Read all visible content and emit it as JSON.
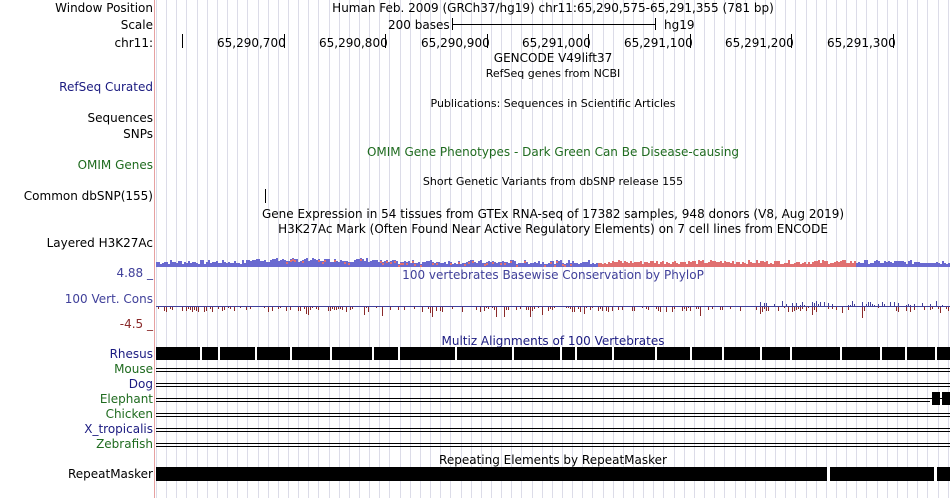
{
  "labels": {
    "window_position": "Window Position",
    "scale": "Scale",
    "chrom": "chr11:",
    "refseq_curated": "RefSeq Curated",
    "sequences": "Sequences",
    "snps": "SNPs",
    "omim_genes": "OMIM Genes",
    "common_dbsnp": "Common dbSNP(155)",
    "layered_h3k27ac": "Layered H3K27Ac",
    "cons_max": "4.88 _",
    "cons_label": "100 Vert. Cons",
    "cons_min": "-4.5 _",
    "rhesus": "Rhesus",
    "mouse": "Mouse",
    "dog": "Dog",
    "elephant": "Elephant",
    "chicken": "Chicken",
    "x_tropicalis": "X_tropicalis",
    "zebrafish": "Zebrafish",
    "repeatmasker": "RepeatMasker"
  },
  "header": {
    "position_text": "Human Feb. 2009 (GRCh37/hg19)   chr11:65,290,575-65,291,355 (781 bp)",
    "scale_text": "200 bases",
    "assembly": "hg19"
  },
  "ruler": {
    "ticks": [
      "65,290,700",
      "65,290,800",
      "65,290,900",
      "65,291,000",
      "65,291,100",
      "65,291,200",
      "65,291,300"
    ]
  },
  "tracks": {
    "gencode": "GENCODE V49lift37",
    "refseq": "RefSeq genes from NCBI",
    "publications": "Publications: Sequences in Scientific Articles",
    "omim": "OMIM Gene Phenotypes - Dark Green Can Be Disease-causing",
    "dbsnp": "Short Genetic Variants from dbSNP release 155",
    "gtex": "Gene Expression in 54 tissues from GTEx RNA-seq of 17382 samples, 948 donors (V8, Aug 2019)",
    "h3k27ac": "H3K27Ac Mark (Often Found Near Active Regulatory Elements) on 7 cell lines from ENCODE",
    "phylop": "100 vertebrates Basewise Conservation by PhyloP",
    "multiz": "Multiz Alignments of 100 Vertebrates",
    "repeatmasker": "Repeating Elements by RepeatMasker"
  },
  "colors": {
    "refseq_label": "#1b1b80",
    "omim": "#1f6b1f",
    "cons_label": "#40409a",
    "cons_neg": "#8a2a2a",
    "multiz_species": "#1f6b1f",
    "h3k27ac_blue": "#6a6ad0",
    "h3k27ac_red": "#e07070",
    "separator": "#e6a0a0",
    "gridline": "#dcdce8"
  }
}
